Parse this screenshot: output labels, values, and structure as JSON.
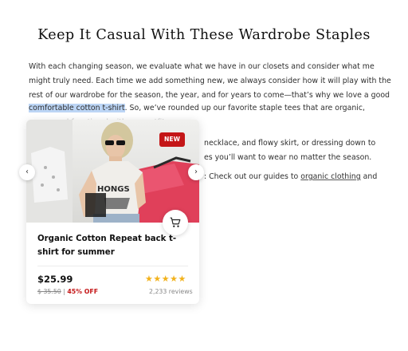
{
  "article": {
    "title": "Keep It Casual With These Wardrobe Staples",
    "p1_line1": "With each changing season, we evaluate what we have in our closets and consider what me",
    "p1_line2": "might truly need. Each time we add something new, we always consider how it will play with the",
    "p1_line3": "rest of our wardrobe for the season, the year, and for years to come—that’s why we love a good",
    "p1_line4_highlight": "comfortable cotton t-shirt",
    "p1_line4_rest": ". So, we’ve rounded up our favorite staple tees that are organic,",
    "p1_line5_faded": "ma    ..n  and functional with any outfit.",
    "p2_line1": "necklace, and flowy skirt, or dressing down to",
    "p2_line2": "es you’ll want to wear no matter the season.",
    "p3_text": ": Check out our guides to ",
    "p3_link": "organic clothing",
    "p3_after": " and"
  },
  "product": {
    "badge": "NEW",
    "name": "Organic Cotton Repeat back t-shirt for summer",
    "price": "$25.99",
    "original_price": "$ 35.50",
    "separator": " | ",
    "discount": "45% OFF",
    "rating": 5,
    "stars": "★★★★★",
    "reviews": "2,233 reviews",
    "shirt_text": "HONGS",
    "cart_icon": "cart-icon"
  },
  "carousel": {
    "prev": "‹",
    "next": "›"
  },
  "colors": {
    "highlight": "#bcd5f5",
    "badge": "#c41617",
    "star": "#f2b21c",
    "discount": "#c41617"
  }
}
